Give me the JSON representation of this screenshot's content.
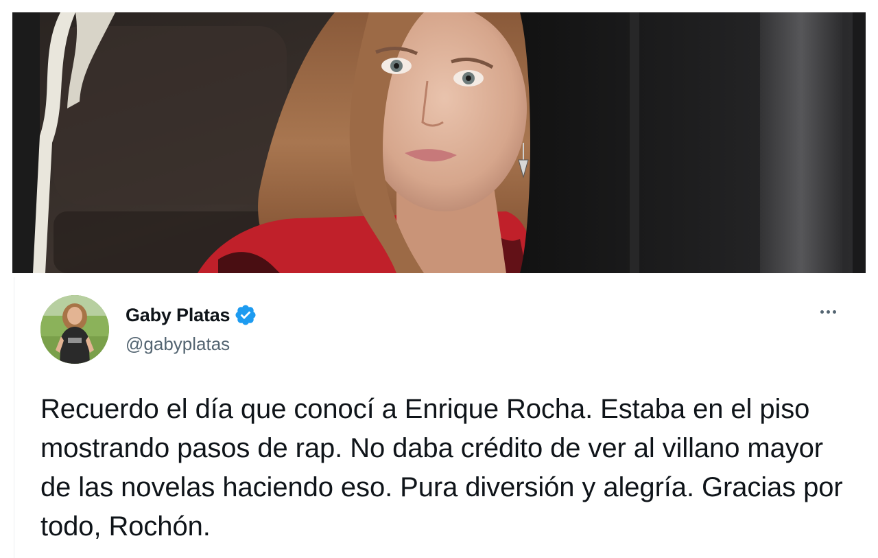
{
  "tweet": {
    "display_name": "Gaby Platas",
    "handle": "@gabyplatas",
    "text": "Recuerdo el día que conocí a Enrique Rocha. Estaba en el piso mostrando pasos de rap. No daba crédito de ver al villano mayor de las novelas haciendo eso. Pura diversión y alegría. Gracias por todo, Rochón.",
    "verified": true
  },
  "icons": {
    "verified": "verified-badge-icon",
    "more": "more-options-icon"
  },
  "colors": {
    "verified_blue": "#1d9bf0",
    "text_primary": "#0f1419",
    "text_secondary": "#536471"
  }
}
